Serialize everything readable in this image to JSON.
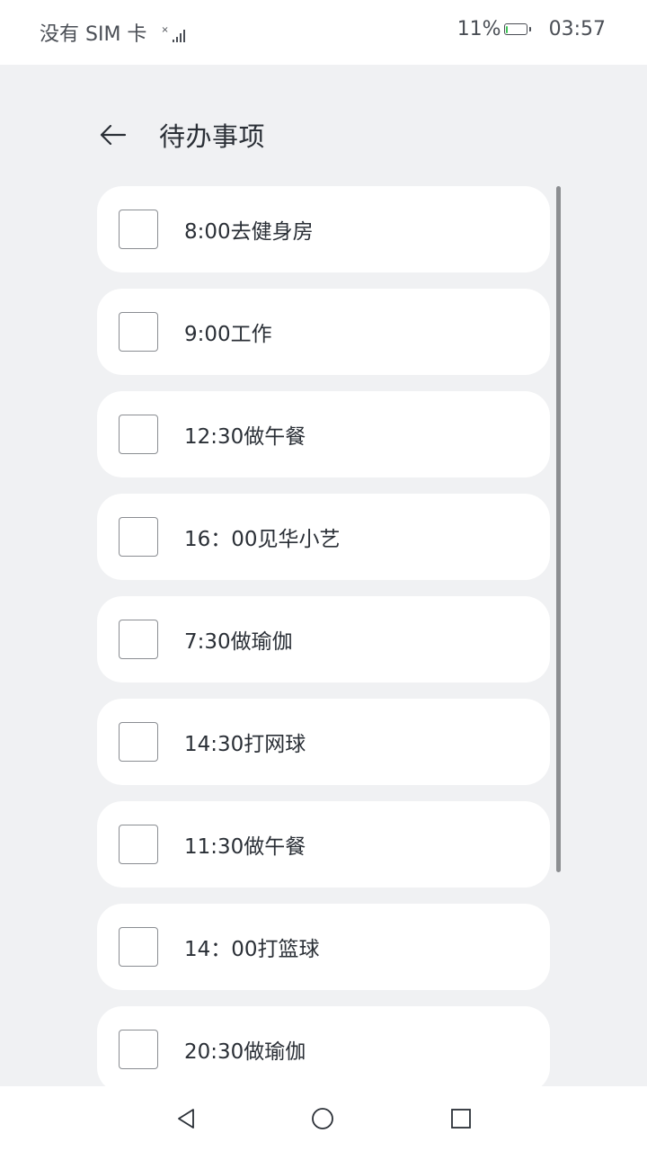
{
  "status_bar": {
    "carrier": "没有 SIM 卡",
    "battery": "11%",
    "battery_level": 0.11,
    "battery_color": "#3fc456",
    "time": "03:57"
  },
  "header": {
    "back_icon": "arrow-left-icon",
    "title": "待办事项"
  },
  "todos": [
    {
      "label": "8:00去健身房",
      "checked": false
    },
    {
      "label": "9:00工作",
      "checked": false
    },
    {
      "label": "12:30做午餐",
      "checked": false
    },
    {
      "label": "16：00见华小艺",
      "checked": false
    },
    {
      "label": "7:30做瑜伽",
      "checked": false
    },
    {
      "label": "14:30打网球",
      "checked": false
    },
    {
      "label": "11:30做午餐",
      "checked": false
    },
    {
      "label": "14：00打篮球",
      "checked": false
    },
    {
      "label": "20:30做瑜伽",
      "checked": false
    }
  ],
  "nav_bar": {
    "back": "triangle-back-icon",
    "home": "circle-home-icon",
    "recents": "square-recents-icon"
  }
}
